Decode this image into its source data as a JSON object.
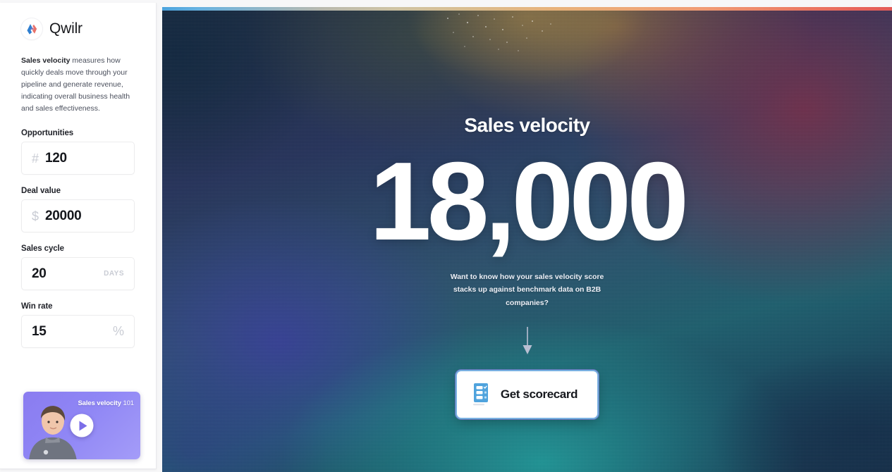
{
  "brand": {
    "name": "Qwilr",
    "logo_icon": "qwilr-logo-icon"
  },
  "sidebar": {
    "intro_bold": "Sales velocity",
    "intro_text": " measures how quickly deals move through your pipeline and generate revenue, indicating overall business health and sales effectiveness.",
    "fields": [
      {
        "label": "Opportunities",
        "prefix": "#",
        "value": "120",
        "suffix": "",
        "name": "opportunities"
      },
      {
        "label": "Deal value",
        "prefix": "$",
        "value": "20000",
        "suffix": "",
        "name": "deal-value"
      },
      {
        "label": "Sales cycle",
        "prefix": "",
        "value": "20",
        "suffix": "DAYS",
        "name": "sales-cycle"
      },
      {
        "label": "Win rate",
        "prefix": "",
        "value": "15",
        "suffix": "%",
        "name": "win-rate"
      }
    ],
    "video": {
      "title": "Sales velocity",
      "title_number": "101",
      "play_icon": "play-icon",
      "accent_color": "#8f86f5"
    }
  },
  "main": {
    "title": "Sales velocity",
    "value": "18,000",
    "subtext": "Want to know how your sales velocity score stacks up against benchmark data on B2B companies?",
    "arrow_icon": "arrow-down-icon",
    "cta": {
      "label": "Get scorecard",
      "icon": "scorecard-icon",
      "icon_color": "#4fa3dd"
    },
    "gradient": {
      "top_strip_from": "#4ba3dd",
      "top_strip_mid": "#d9bd8f",
      "top_strip_to": "#e35a57",
      "panel_navy": "#1c2b3f",
      "panel_teal": "#1d5e6d",
      "panel_indigo": "#363e96",
      "panel_maroon": "#702e4a"
    }
  }
}
